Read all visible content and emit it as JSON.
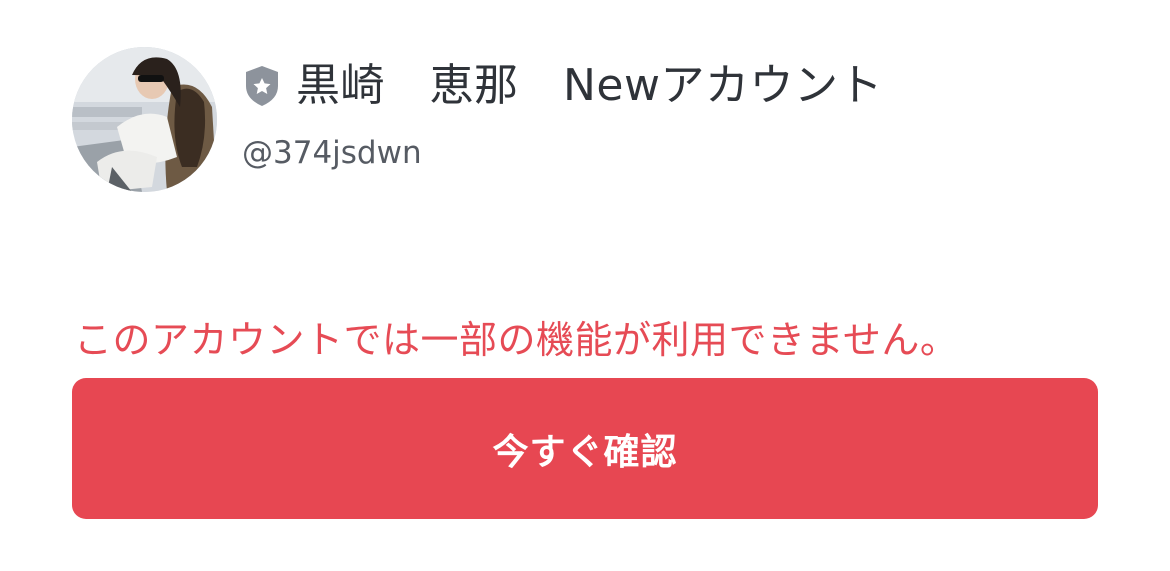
{
  "profile": {
    "display_name": "黒崎　恵那　Newアカウント",
    "handle": "@374jsdwn",
    "badge_icon": "shield-star-icon",
    "avatar": "profile-photo"
  },
  "notice": {
    "message": "このアカウントでは一部の機能が利用できません。"
  },
  "actions": {
    "confirm_label": "今すぐ確認"
  },
  "colors": {
    "accent": "#e74752",
    "warning_text": "#e64b55",
    "badge": "#8d939c",
    "name_text": "#2f3339",
    "handle_text": "#565b63"
  }
}
